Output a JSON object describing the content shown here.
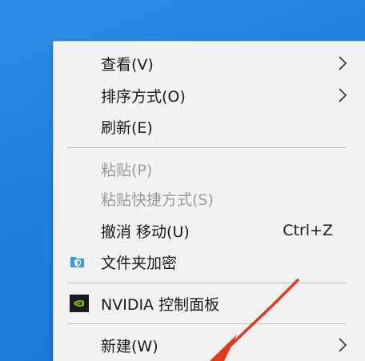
{
  "menu": {
    "items": [
      {
        "label": "查看(V)"
      },
      {
        "label": "排序方式(O)"
      },
      {
        "label": "刷新(E)"
      },
      {
        "label": "粘贴(P)"
      },
      {
        "label": "粘贴快捷方式(S)"
      },
      {
        "label": "撤消 移动(U)",
        "shortcut": "Ctrl+Z"
      },
      {
        "label": "文件夹加密"
      },
      {
        "label": "NVIDIA 控制面板"
      },
      {
        "label": "新建(W)"
      }
    ]
  },
  "icons": {
    "folder_lock": "folder-shield-icon",
    "nvidia": "nvidia-logo-icon",
    "submenu": "chevron-right-icon"
  },
  "colors": {
    "desktop": "#1f7fdc",
    "menu_bg": "#f2f2f2",
    "disabled_text": "#9b9b9b",
    "annotation_arrow": "#e8361c"
  }
}
